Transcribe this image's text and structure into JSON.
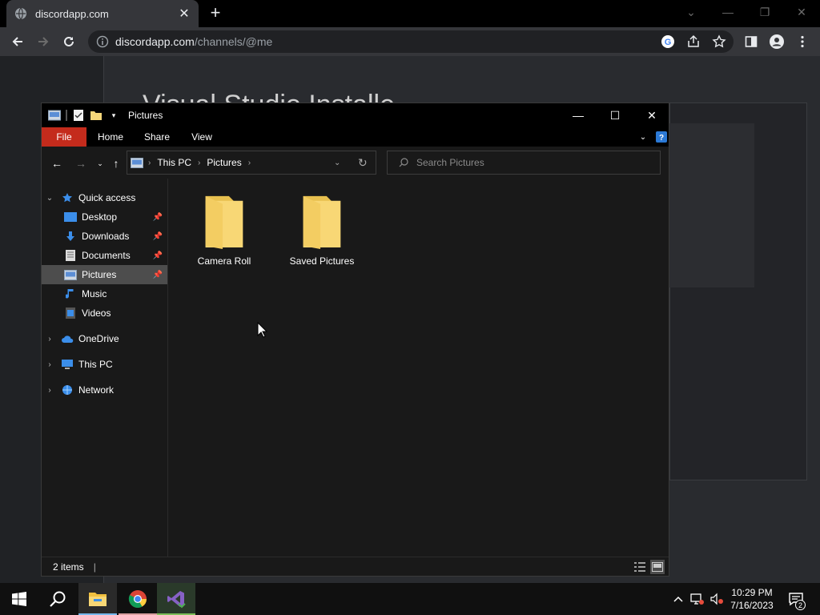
{
  "browser": {
    "tab_title": "discordapp.com",
    "url_host": "discordapp.com",
    "url_path": "/channels/@me",
    "page_heading_partial": "Visual Studio Installe"
  },
  "explorer": {
    "window_title": "Pictures",
    "ribbon": {
      "file": "File",
      "home": "Home",
      "share": "Share",
      "view": "View"
    },
    "address": {
      "crumb_1": "This PC",
      "crumb_2": "Pictures"
    },
    "search_placeholder": "Search Pictures",
    "nav": {
      "quick_access": "Quick access",
      "desktop": "Desktop",
      "downloads": "Downloads",
      "documents": "Documents",
      "pictures": "Pictures",
      "music": "Music",
      "videos": "Videos",
      "onedrive": "OneDrive",
      "this_pc": "This PC",
      "network": "Network"
    },
    "folders": [
      {
        "name": "Camera Roll"
      },
      {
        "name": "Saved Pictures"
      }
    ],
    "status_items": "2 items"
  },
  "taskbar": {
    "time": "10:29 PM",
    "date": "7/16/2023",
    "notification_count": "2"
  },
  "colors": {
    "file_tab_red": "#c42b1c",
    "folder_yellow": "#f6d77a",
    "selected_nav": "#4d4d4d"
  }
}
